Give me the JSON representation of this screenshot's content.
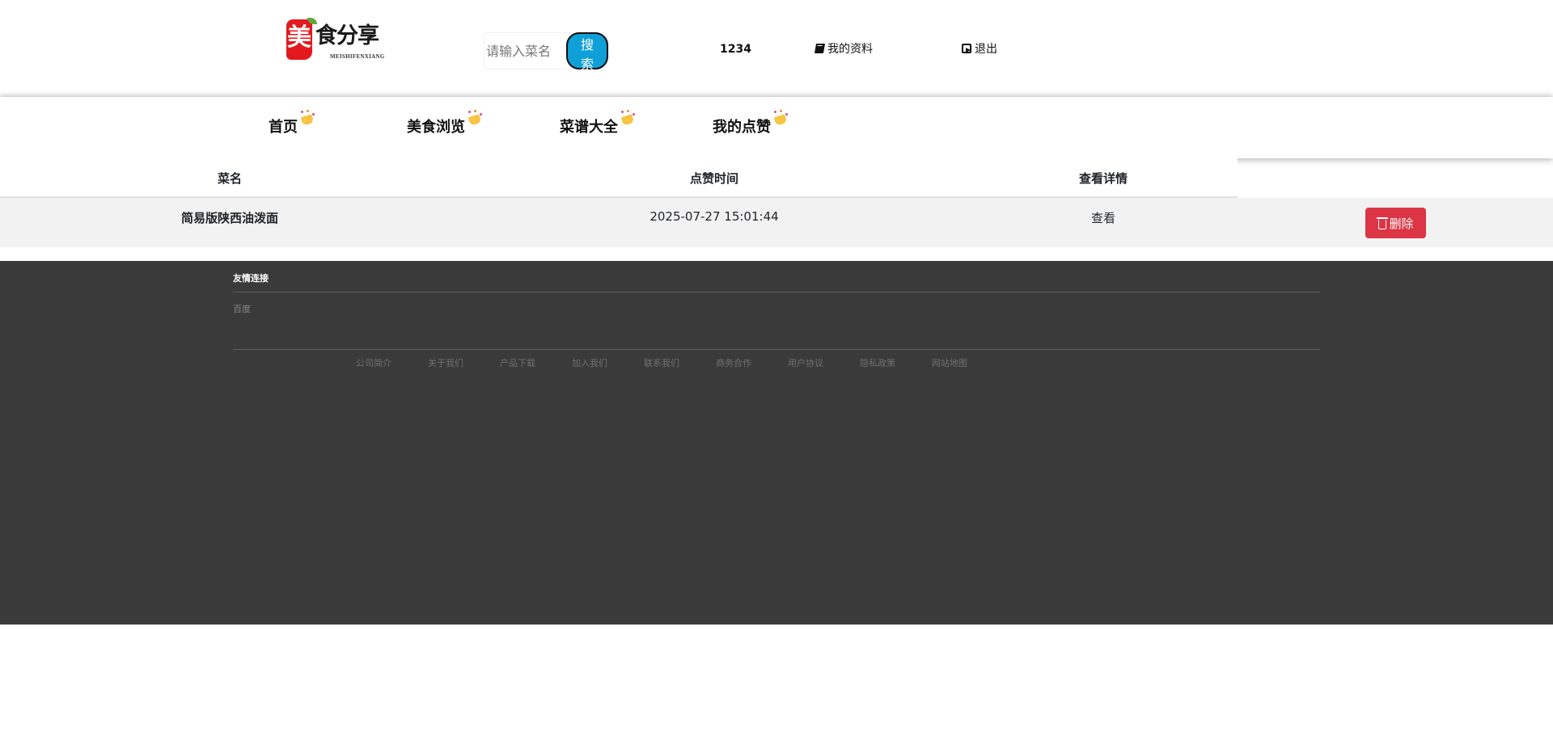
{
  "header": {
    "logo": {
      "seal_char": "美",
      "brand_text": "食分享",
      "sub_text": "MEISHIFENXIANG"
    },
    "search": {
      "placeholder": "请输入菜名",
      "button_label": "搜 索",
      "button_color": "#0fa0d8"
    },
    "user_id": "1234",
    "profile_label": "我的资料",
    "profile_icon": "book-icon",
    "logout_label": "退出",
    "logout_icon": "sign-out-icon"
  },
  "nav": {
    "items": [
      {
        "label": "首页",
        "icon": "sparkle-badge-icon"
      },
      {
        "label": "美食浏览",
        "icon": "sparkle-badge-icon"
      },
      {
        "label": "菜谱大全",
        "icon": "sparkle-badge-icon"
      },
      {
        "label": "我的点赞",
        "icon": "sparkle-badge-icon"
      }
    ]
  },
  "table": {
    "columns": [
      "菜名",
      "点赞时间",
      "查看详情"
    ],
    "rows": [
      {
        "dish": "简易版陕西油泼面",
        "liked_at": "2025-07-27 15:01:44",
        "view_label": "查看",
        "delete_label": "删除",
        "delete_icon": "trash-icon"
      }
    ],
    "row_bg": "#f2f2f2",
    "delete_color": "#dc3545"
  },
  "footer": {
    "friend_links_title": "友情连接",
    "friend_links": [
      "百度"
    ],
    "links": [
      "公司简介",
      "关于我们",
      "产品下载",
      "加入我们",
      "联系我们",
      "商务合作",
      "用户协议",
      "隐私政策",
      "网站地图"
    ],
    "bg_color": "#3a3a3a"
  }
}
